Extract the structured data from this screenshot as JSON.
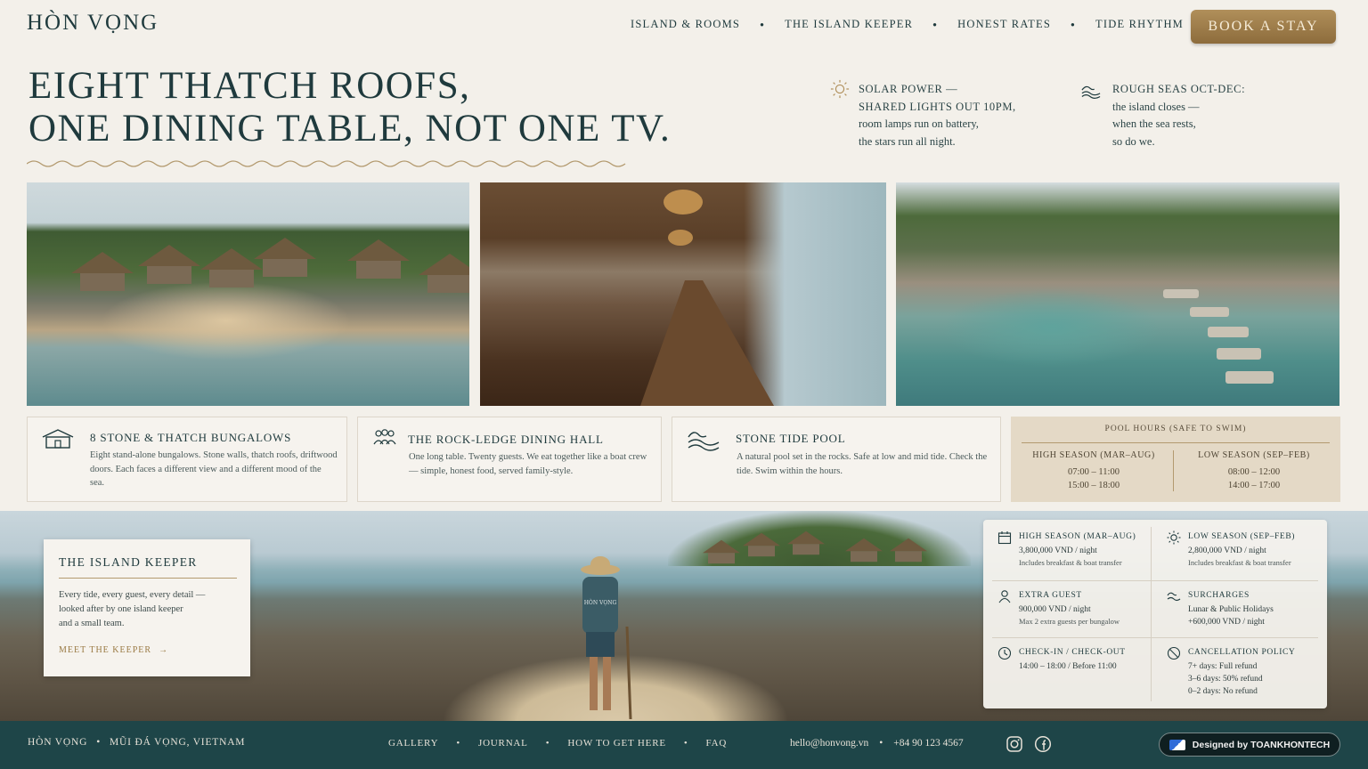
{
  "brand": {
    "logo": "HÒN VỌNG"
  },
  "nav": {
    "items": [
      "ISLAND & ROOMS",
      "THE ISLAND KEEPER",
      "HONEST RATES",
      "TIDE RHYTHM"
    ],
    "cta": "BOOK A STAY"
  },
  "hero": {
    "headline_line1": "EIGHT THATCH ROOFS,",
    "headline_line2": "ONE DINING TABLE, NOT ONE TV.",
    "note1": {
      "icon": "sun-icon",
      "lead1": "SOLAR POWER —",
      "lead2": "SHARED LIGHTS OUT 10PM,",
      "line3": "room lamps run on battery,",
      "line4": "the stars run all night."
    },
    "note2": {
      "icon": "waves-icon",
      "lead1": "ROUGH SEAS OCT-DEC:",
      "line2": "the island closes —",
      "line3": "when the sea rests,",
      "line4": "so do we."
    }
  },
  "features": [
    {
      "icon": "bungalow-icon",
      "title": "8 STONE & THATCH BUNGALOWS",
      "body": "Eight stand-alone bungalows. Stone walls, thatch roofs, driftwood doors. Each faces a different view and a different mood of the sea."
    },
    {
      "icon": "people-icon",
      "title": "THE ROCK-LEDGE DINING HALL",
      "body": "One long table. Twenty guests. We eat together like a boat crew — simple, honest food, served family-style."
    },
    {
      "icon": "wave-icon",
      "title": "STONE TIDE POOL",
      "body": "A natural pool set in the rocks. Safe at low and mid tide. Check the tide. Swim within the hours."
    }
  ],
  "pool": {
    "title": "POOL HOURS (SAFE TO SWIM)",
    "high": {
      "label": "HIGH SEASON (MAR–AUG)",
      "slot1": "07:00  –  11:00",
      "slot2": "15:00  –  18:00"
    },
    "low": {
      "label": "LOW SEASON (SEP–FEB)",
      "slot1": "08:00  –  12:00",
      "slot2": "14:00  –  17:00"
    }
  },
  "keeper": {
    "title": "THE ISLAND KEEPER",
    "line1": "Every tide, every guest, every detail —",
    "line2": "looked after by one island keeper",
    "line3": "and a small team.",
    "link": "MEET THE KEEPER",
    "shirt_text": "HÒN VỌNG"
  },
  "rates": {
    "high": {
      "title": "HIGH SEASON (MAR–AUG)",
      "price": "3,800,000 VND / night",
      "note": "Includes breakfast & boat transfer"
    },
    "low": {
      "title": "LOW SEASON (SEP–FEB)",
      "price": "2,800,000 VND / night",
      "note": "Includes breakfast & boat transfer"
    },
    "extra": {
      "title": "EXTRA GUEST",
      "price": "900,000 VND / night",
      "note": "Max 2 extra guests per bungalow"
    },
    "surcharge": {
      "title": "SURCHARGES",
      "line1": "Lunar & Public Holidays",
      "line2": "+600,000 VND / night"
    },
    "checkin": {
      "title": "CHECK-IN / CHECK-OUT",
      "line1": "14:00 – 18:00 / Before 11:00"
    },
    "cancel": {
      "title": "CANCELLATION POLICY",
      "line1": "7+ days: Full refund",
      "line2": "3–6 days: 50% refund",
      "line3": "0–2 days: No refund"
    }
  },
  "footer": {
    "brand": "HÒN VỌNG",
    "location": "MŨI ĐÁ VỌNG, VIETNAM",
    "nav": [
      "GALLERY",
      "JOURNAL",
      "HOW TO GET HERE",
      "FAQ"
    ],
    "email": "hello@honvong.vn",
    "phone": "+84 90 123 4567",
    "badge": "Designed by TOANKHONTECH"
  },
  "colors": {
    "primary": "#1f3a3d",
    "gold": "#9a7a44",
    "footer": "#1e4548",
    "background": "#f3f0ea"
  }
}
